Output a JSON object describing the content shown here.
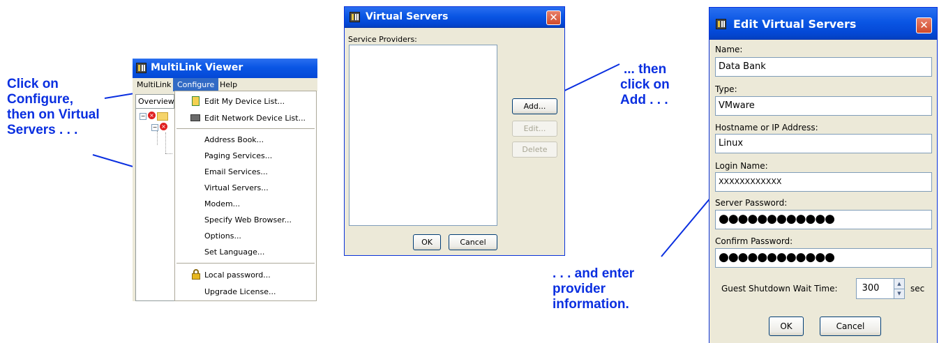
{
  "callouts": {
    "left": [
      "Click on",
      "Configure,",
      "then on Virtual",
      "Servers . . ."
    ],
    "middle": [
      "... then",
      "click on",
      "Add . . ."
    ],
    "right": [
      ". . . and enter",
      "provider",
      "information."
    ]
  },
  "multilink": {
    "title": "MultiLink Viewer",
    "menubar": [
      "MultiLink",
      "Configure",
      "Help"
    ],
    "tab": "Overview",
    "menu_items": [
      {
        "label": "Edit My Device List...",
        "icon": "device-list-icon"
      },
      {
        "label": "Edit Network Device List...",
        "icon": "network-device-icon"
      },
      {
        "label": "Address Book..."
      },
      {
        "label": "Paging Services..."
      },
      {
        "label": "Email Services..."
      },
      {
        "label": "Virtual Servers..."
      },
      {
        "label": "Modem..."
      },
      {
        "label": "Specify Web Browser..."
      },
      {
        "label": "Options..."
      },
      {
        "label": "Set Language..."
      },
      {
        "label": "Local password...",
        "icon": "lock-icon"
      },
      {
        "label": "Upgrade License..."
      }
    ]
  },
  "virtual_servers": {
    "title": "Virtual Servers",
    "list_label": "Service Providers:",
    "add": "Add...",
    "edit": "Edit...",
    "delete": "Delete",
    "ok": "OK",
    "cancel": "Cancel"
  },
  "edit_dialog": {
    "title": "Edit Virtual Servers",
    "name_label": "Name:",
    "name_value": "Data Bank",
    "type_label": "Type:",
    "type_value": "VMware",
    "host_label": "Hostname or IP Address:",
    "host_value": "Linux",
    "login_label": "Login Name:",
    "login_value": "XXXXXXXXXXXX",
    "password_label": "Server Password:",
    "password_value": "●●●●●●●●●●●●",
    "confirm_label": "Confirm Password:",
    "confirm_value": "●●●●●●●●●●●●",
    "wait_label": "Guest Shutdown Wait Time:",
    "wait_value": "300",
    "wait_unit": "sec",
    "ok": "OK",
    "cancel": "Cancel"
  },
  "colors": {
    "callout": "#0a2fe0",
    "xp_title": "#0a56e4",
    "xp_face": "#ece9d8",
    "close": "#d04a2a"
  }
}
